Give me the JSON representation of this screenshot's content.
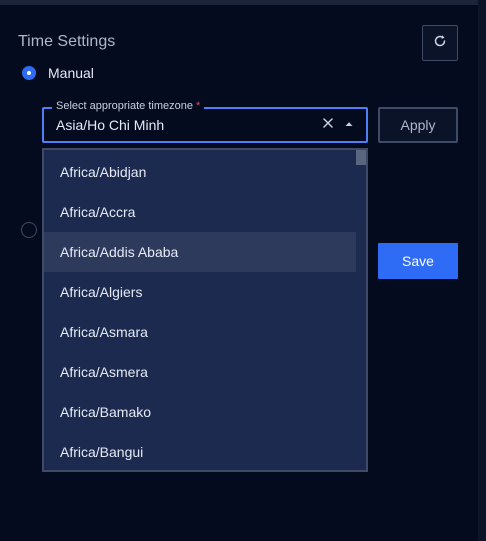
{
  "header": {
    "title": "Time Settings",
    "refresh_icon": "refresh-icon"
  },
  "manual_option": {
    "label": "Manual",
    "selected": true
  },
  "timezone_field": {
    "legend": "Select appropriate timezone",
    "required_mark": "*",
    "value": "Asia/Ho Chi Minh",
    "clear_icon": "close-icon",
    "toggle_icon": "caret-up-icon"
  },
  "apply_label": "Apply",
  "save_label": "Save",
  "timezone_options": [
    "Africa/Abidjan",
    "Africa/Accra",
    "Africa/Addis Ababa",
    "Africa/Algiers",
    "Africa/Asmara",
    "Africa/Asmera",
    "Africa/Bamako",
    "Africa/Bangui"
  ],
  "hovered_option": "Africa/Addis Ababa",
  "colors": {
    "background": "#050b1f",
    "accent": "#2f6cf5",
    "dropdown_bg": "#1b2a4e",
    "hover_bg": "#2e3a5c",
    "border": "#3e4a66",
    "required": "#e5484d"
  }
}
